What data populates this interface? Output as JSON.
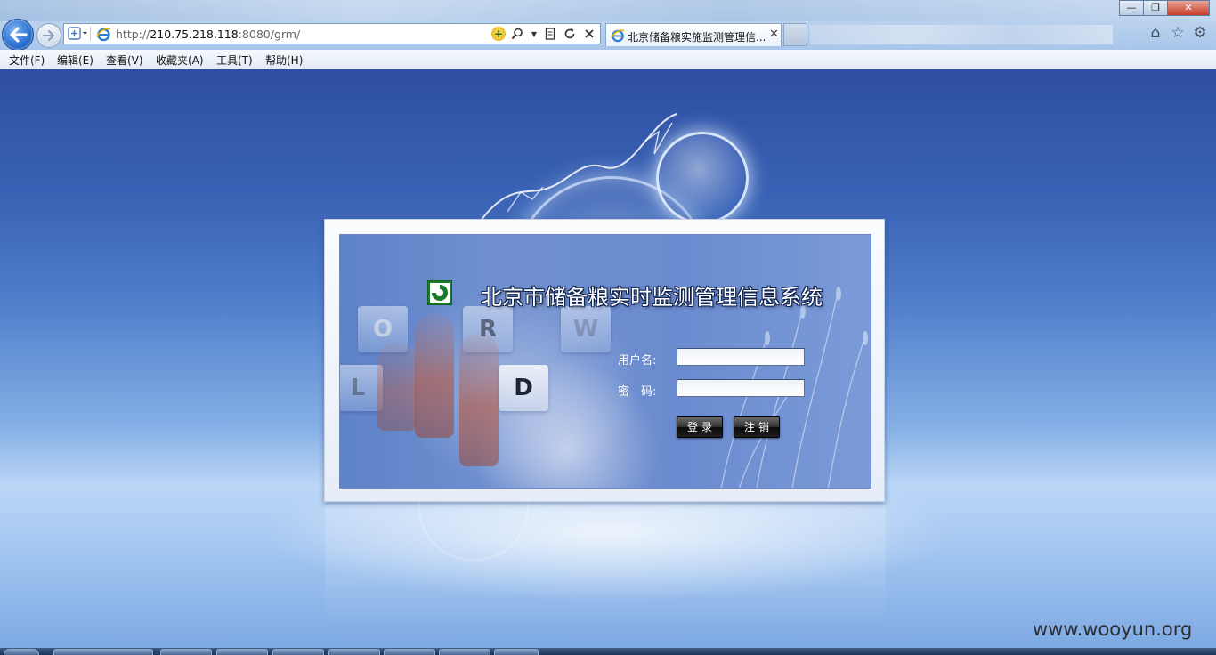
{
  "browser": {
    "address": {
      "prefix": "http://",
      "host": "210.75.218.118",
      "rest": ":8080/grm/"
    },
    "active_tab_title": "北京储备粮实施监测管理信...",
    "window_buttons": [
      "—",
      "❐",
      "✕"
    ]
  },
  "menu": {
    "items": [
      "文件(F)",
      "编辑(E)",
      "查看(V)",
      "收藏夹(A)",
      "工具(T)",
      "帮助(H)"
    ]
  },
  "login": {
    "system_title": "北京市储备粮实时监测管理信息系统",
    "username_label": "用户名:",
    "username_value": "",
    "password_label": "密　码:",
    "password_value": "",
    "login_button": "登录",
    "cancel_button": "注销",
    "decor_keys": [
      "O",
      "R",
      "W",
      "D",
      "L"
    ]
  },
  "watermark": "www.wooyun.org",
  "colors": {
    "accent": "#2f5aa8",
    "logo_green": "#1a7a2a"
  },
  "icons": [
    "back-arrow-icon",
    "forward-arrow-icon",
    "compatibility-icon",
    "ie-icon",
    "go-icon",
    "search-icon",
    "refresh-icon",
    "stop-icon",
    "home-icon",
    "favorites-star-icon",
    "settings-gear-icon",
    "system-logo-icon"
  ]
}
